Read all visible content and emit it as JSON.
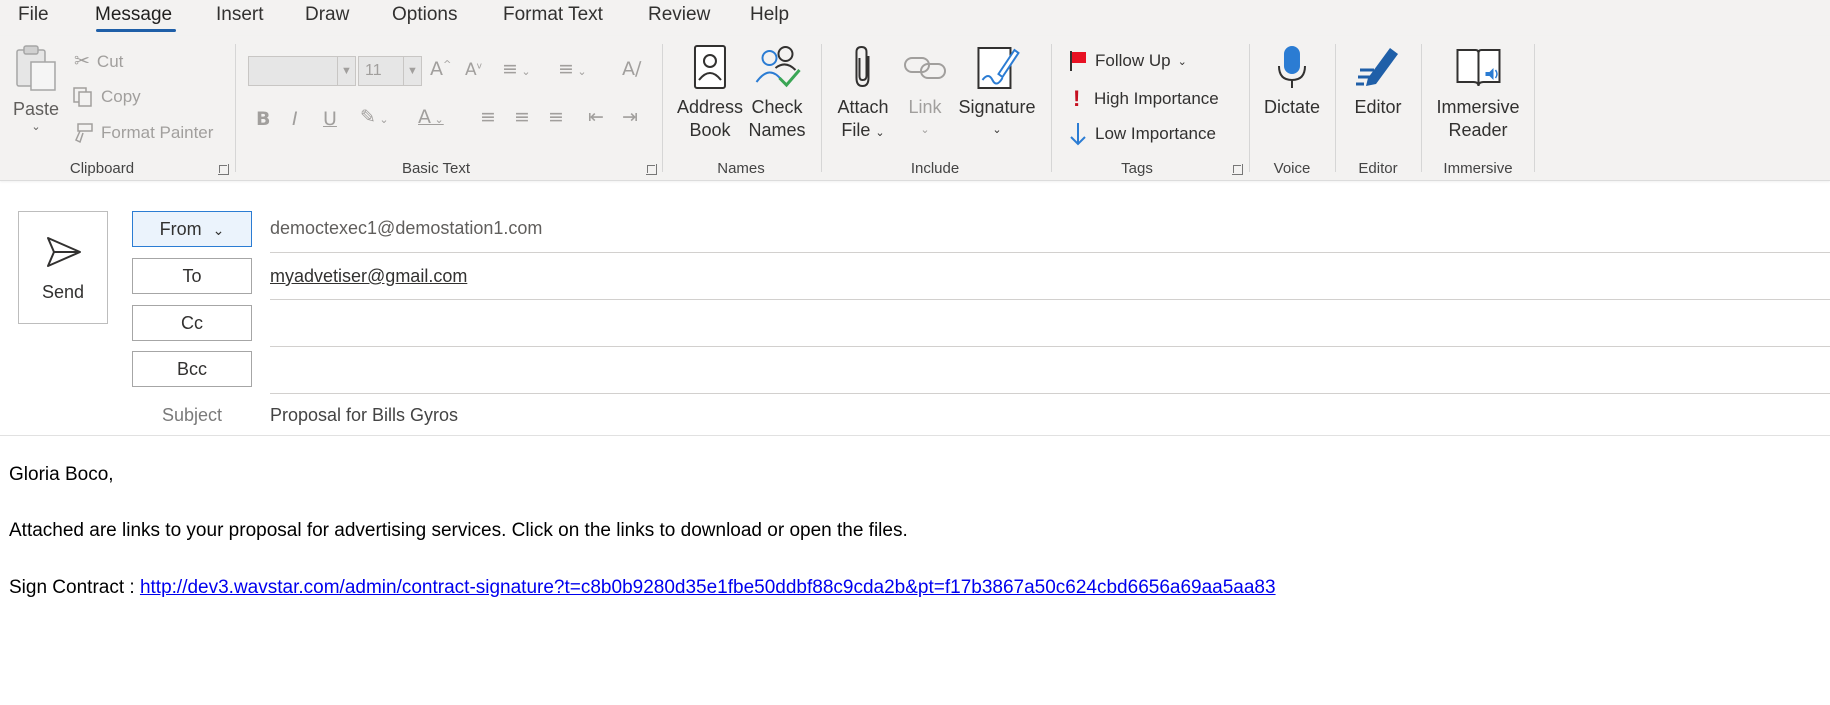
{
  "tabs": [
    {
      "label": "File"
    },
    {
      "label": "Message"
    },
    {
      "label": "Insert"
    },
    {
      "label": "Draw"
    },
    {
      "label": "Options"
    },
    {
      "label": "Format Text"
    },
    {
      "label": "Review"
    },
    {
      "label": "Help"
    }
  ],
  "ribbon": {
    "clipboard": {
      "group": "Clipboard",
      "paste": "Paste",
      "cut": "Cut",
      "copy": "Copy",
      "format_painter": "Format Painter"
    },
    "basic_text": {
      "group": "Basic Text",
      "font_size": "11",
      "bold": "B",
      "italic": "I",
      "underline": "U"
    },
    "names": {
      "group": "Names",
      "address_book_1": "Address",
      "address_book_2": "Book",
      "check_names_1": "Check",
      "check_names_2": "Names"
    },
    "include": {
      "group": "Include",
      "attach_1": "Attach",
      "attach_2": "File",
      "link": "Link",
      "signature": "Signature"
    },
    "tags": {
      "group": "Tags",
      "follow_up": "Follow Up",
      "high_importance": "High Importance",
      "low_importance": "Low Importance"
    },
    "voice": {
      "group": "Voice",
      "dictate": "Dictate"
    },
    "editor": {
      "group": "Editor",
      "editor": "Editor"
    },
    "immersive": {
      "group": "Immersive",
      "reader_1": "Immersive",
      "reader_2": "Reader"
    }
  },
  "compose": {
    "send_label": "Send",
    "from_label": "From",
    "from_value": "democtexec1@demostation1.com",
    "to_label": "To",
    "to_value": "myadvetiser@gmail.com",
    "cc_label": "Cc",
    "bcc_label": "Bcc",
    "subject_label": "Subject",
    "subject_value": "Proposal  for Bills Gyros"
  },
  "body": {
    "greeting": "Gloria Boco,",
    "line1": "Attached are links to your proposal for advertising services. Click on the links to download or open the files.",
    "sign_label": "Sign Contract : ",
    "sign_link": "http://dev3.wavstar.com/admin/contract-signature?t=c8b0b9280d35e1fbe50ddbf88c9cda2b&pt=f17b3867a50c624cbd6656a69aa5aa83"
  },
  "colors": {
    "accent": "#1f5fa8",
    "link": "#0000ee",
    "flag": "#e81123",
    "importance": "#c50f1f",
    "icon_blue": "#2b7cd3"
  }
}
